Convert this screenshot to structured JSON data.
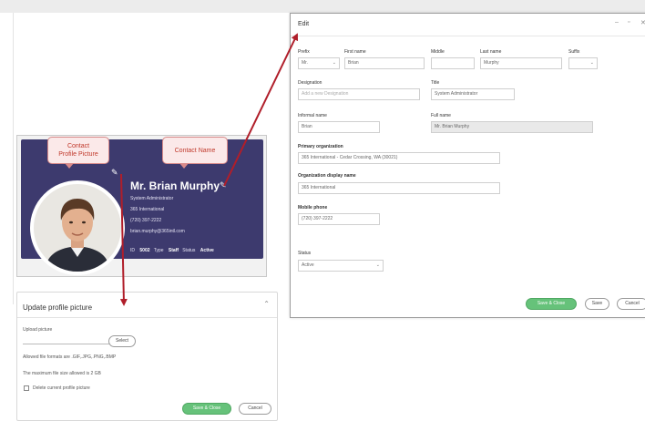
{
  "contact_card": {
    "callout_photo": "Contact\nProfile Picture",
    "callout_name": "Contact Name",
    "name": "Mr. Brian Murphy",
    "lines": [
      "System Administrator",
      "365 International",
      "(720) 397-2222",
      "brian.murphy@365intl.com"
    ],
    "meta": {
      "id_label": "ID",
      "id_value": "5002",
      "type_label": "Type",
      "type_value": "Staff",
      "status_label": "Status",
      "status_value": "Active"
    }
  },
  "update_picture": {
    "title": "Update profile picture",
    "upload_label": "Upload picture",
    "select_label": "Select",
    "formats_text": "Allowed file formats are .GIF,.JPG,.PNG,.BMP",
    "size_text": "The maximum file size allowed is 2 GB",
    "delete_label": "Delete current profile picture",
    "save_close": "Save & Close",
    "cancel": "Cancel"
  },
  "edit": {
    "title": "Edit",
    "prefix": {
      "label": "Prefix",
      "value": "Mr."
    },
    "first_name": {
      "label": "First name",
      "value": "Brian"
    },
    "middle": {
      "label": "Middle",
      "value": ""
    },
    "last_name": {
      "label": "Last name",
      "value": "Murphy"
    },
    "suffix": {
      "label": "Suffix",
      "value": ""
    },
    "designation": {
      "label": "Designation",
      "placeholder": "Add a new Designation"
    },
    "title_field": {
      "label": "Title",
      "value": "System Administrator"
    },
    "informal_name": {
      "label": "Informal name",
      "value": "Brian"
    },
    "full_name": {
      "label": "Full name",
      "value": "Mr. Brian Murphy"
    },
    "primary_org": {
      "label": "Primary organization",
      "value": "365 International - Cedar Crossing, WA (30021)"
    },
    "org_display": {
      "label": "Organization display name",
      "value": "365 International"
    },
    "mobile": {
      "label": "Mobile phone",
      "value": "(720) 397-2222"
    },
    "status": {
      "label": "Status",
      "value": "Active"
    },
    "save_close": "Save & Close",
    "save": "Save",
    "cancel": "Cancel"
  },
  "colors": {
    "card_bg": "#3d3a6e",
    "arrow": "#b01e2a",
    "primary_button": "#66c27a"
  },
  "icons": [
    "pencil-icon",
    "close-icon",
    "minimize-icon",
    "maximize-icon",
    "chevron-down-icon"
  ]
}
